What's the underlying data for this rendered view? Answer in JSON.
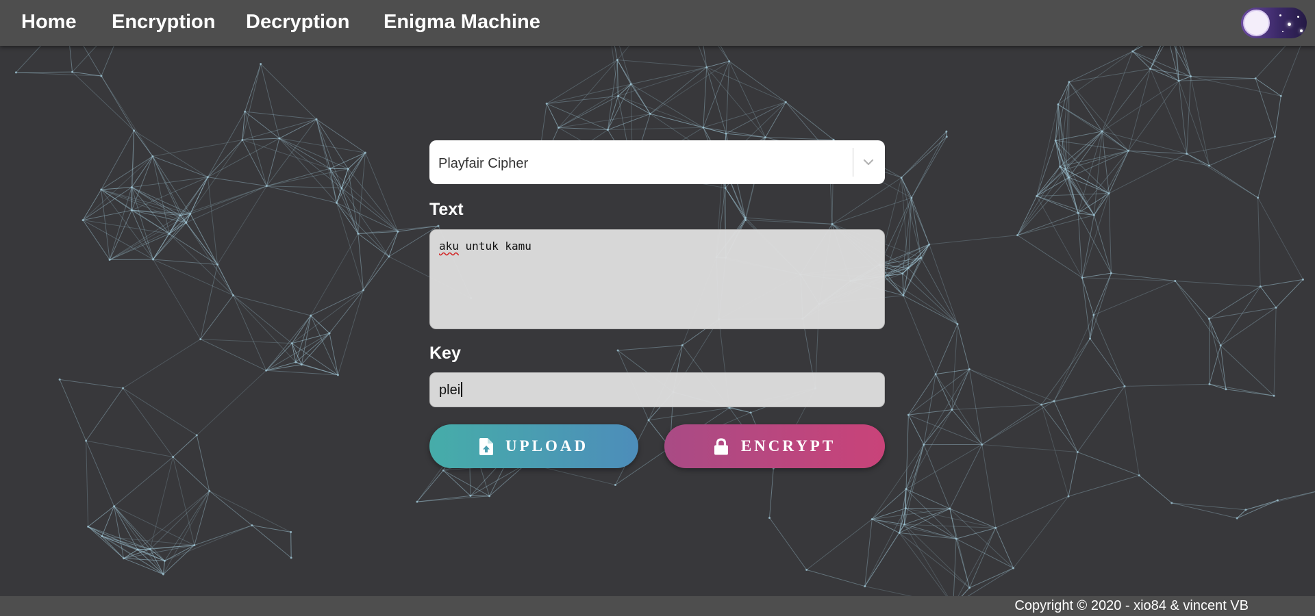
{
  "nav": {
    "items": [
      {
        "label": "Home"
      },
      {
        "label": "Encryption"
      },
      {
        "label": "Decryption"
      },
      {
        "label": "Enigma Machine"
      }
    ],
    "theme_toggle_state": "dark"
  },
  "form": {
    "cipher_select": {
      "selected": "Playfair Cipher"
    },
    "text_label": "Text",
    "text_value_misspelled": "aku",
    "text_value_rest": " untuk kamu",
    "key_label": "Key",
    "key_value": "plei",
    "upload_label": "UPLOAD",
    "encrypt_label": "ENCRYPT"
  },
  "footer": {
    "copyright": "Copyright © 2020 - xio84 & vincent VB"
  },
  "colors": {
    "background": "#38383b",
    "navbar": "#4e4e4e",
    "network_lines": "#9fc4d3",
    "upload_gradient": [
      "#46ada9",
      "#4d8dba"
    ],
    "encrypt_gradient": [
      "#a94b85",
      "#c94379"
    ]
  },
  "icons": {
    "select": "chevron-down-icon",
    "upload": "file-upload-icon",
    "encrypt": "lock-icon",
    "theme": "moon-icon"
  }
}
